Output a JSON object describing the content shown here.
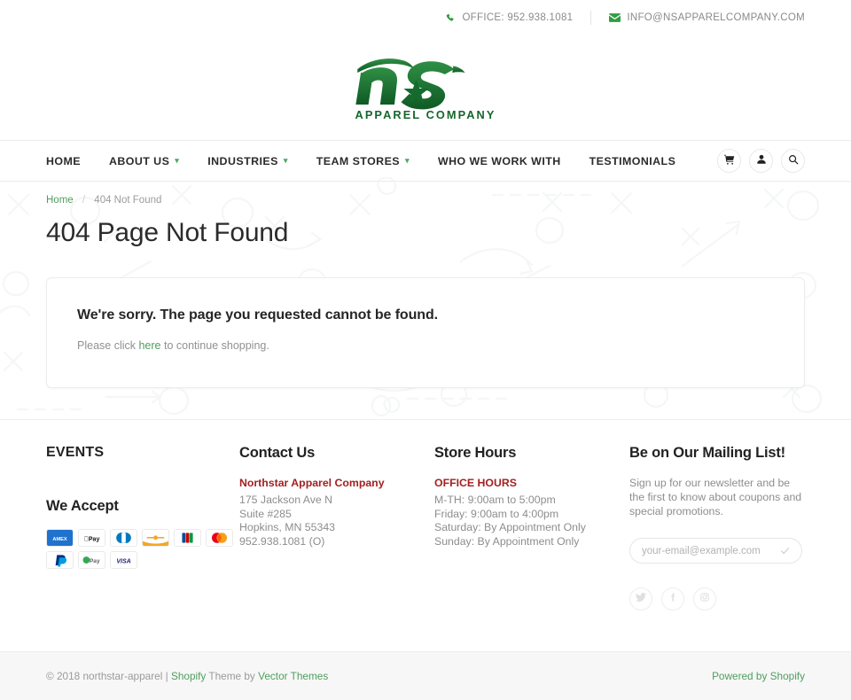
{
  "topbar": {
    "phone_icon": "phone-icon",
    "phone": "OFFICE: 952.938.1081",
    "email_icon": "envelope-icon",
    "email": "INFO@NSAPPARELCOMPANY.COM"
  },
  "logo": {
    "name": "ns-apparel-company-logo",
    "mark": "n★s",
    "tagline": "APPAREL COMPANY",
    "color": "#1f7a35"
  },
  "nav": {
    "items": [
      {
        "label": "HOME",
        "has_caret": false
      },
      {
        "label": "ABOUT US",
        "has_caret": true
      },
      {
        "label": "INDUSTRIES",
        "has_caret": true
      },
      {
        "label": "TEAM STORES",
        "has_caret": true
      },
      {
        "label": "WHO WE WORK WITH",
        "has_caret": false
      },
      {
        "label": "TESTIMONIALS",
        "has_caret": false
      }
    ],
    "caret_glyph": "▾",
    "icons": [
      {
        "name": "cart-icon"
      },
      {
        "name": "user-icon"
      },
      {
        "name": "search-icon"
      }
    ]
  },
  "breadcrumb": {
    "home": "Home",
    "separator": "/",
    "current": "404 Not Found"
  },
  "page": {
    "title": "404 Page Not Found"
  },
  "error_card": {
    "heading": "We're sorry. The page you requested cannot be found.",
    "text_before": "Please click ",
    "link": "here",
    "text_after": " to continue shopping."
  },
  "footer": {
    "events": {
      "heading": "EVENTS"
    },
    "contact": {
      "heading": "Contact Us",
      "company": "Northstar Apparel Company",
      "lines": [
        "175 Jackson Ave N",
        "Suite #285",
        "Hopkins, MN 55343",
        "952.938.1081 (O)"
      ]
    },
    "hours": {
      "heading": "Store Hours",
      "label": "OFFICE HOURS",
      "lines": [
        "M-TH: 9:00am to 5:00pm",
        "Friday: 9:00am to 4:00pm",
        "Saturday: By Appointment Only",
        "Sunday: By Appointment Only"
      ]
    },
    "mailing": {
      "heading": "Be on Our Mailing List!",
      "blurb": "Sign up for our newsletter and be the first to know about coupons and special promotions.",
      "placeholder": "your-email@example.com",
      "value": "",
      "submit_icon": "check-icon"
    },
    "accept": {
      "heading": "We Accept",
      "methods": [
        {
          "name": "amex",
          "label": "AMEX"
        },
        {
          "name": "apple-pay",
          "label": "Pay"
        },
        {
          "name": "diners-club",
          "label": "Diners"
        },
        {
          "name": "discover",
          "label": "Discover"
        },
        {
          "name": "jcb",
          "label": "JCB"
        },
        {
          "name": "mastercard",
          "label": "Mastercard"
        },
        {
          "name": "paypal",
          "label": "PayPal"
        },
        {
          "name": "google-pay",
          "label": "Pay"
        },
        {
          "name": "visa",
          "label": "VISA"
        }
      ]
    },
    "socials": [
      {
        "name": "twitter-icon"
      },
      {
        "name": "facebook-icon"
      },
      {
        "name": "instagram-icon"
      }
    ]
  },
  "bottombar": {
    "copyright_prefix": "© 2018 northstar-apparel | ",
    "shopify": "Shopify",
    "theme_by": " Theme by ",
    "vector_themes": "Vector Themes",
    "powered_by": "Powered by Shopify"
  }
}
